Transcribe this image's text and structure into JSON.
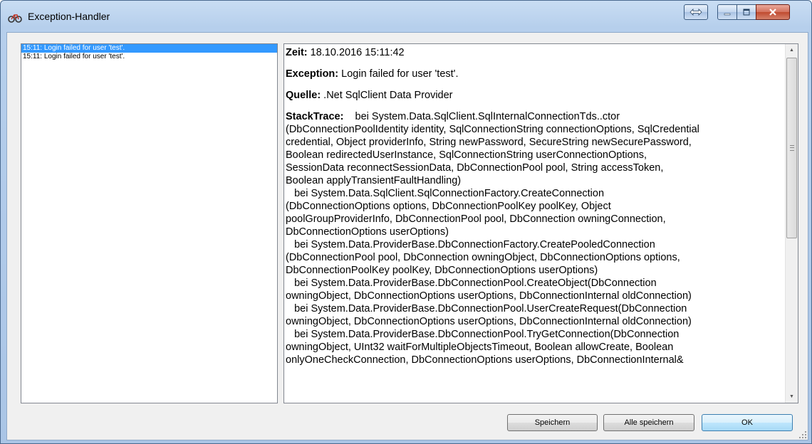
{
  "window": {
    "title": "Exception-Handler",
    "icon": "bicycle-app-icon",
    "accent": "#3399ff"
  },
  "log_list": {
    "items": [
      "15:11: Login failed for user 'test'.",
      "15:11: Login failed for user 'test'."
    ],
    "selected_index": 0
  },
  "detail": {
    "zeit_label": "Zeit:",
    "zeit_value": " 18.10.2016 15:11:42",
    "exception_label": "Exception:",
    "exception_value": " Login failed for user 'test'.",
    "quelle_label": "Quelle:",
    "quelle_value": " .Net SqlClient Data Provider",
    "stacktrace_label": "StackTrace:",
    "stacktrace_lines": [
      "    bei System.Data.SqlClient.SqlInternalConnectionTds..ctor",
      "(DbConnectionPoolIdentity identity, SqlConnectionString connectionOptions, SqlCredential",
      "credential, Object providerInfo, String newPassword, SecureString newSecurePassword,",
      "Boolean redirectedUserInstance, SqlConnectionString userConnectionOptions,",
      "SessionData reconnectSessionData, DbConnectionPool pool, String accessToken,",
      "Boolean applyTransientFaultHandling)",
      "   bei System.Data.SqlClient.SqlConnectionFactory.CreateConnection",
      "(DbConnectionOptions options, DbConnectionPoolKey poolKey, Object",
      "poolGroupProviderInfo, DbConnectionPool pool, DbConnection owningConnection,",
      "DbConnectionOptions userOptions)",
      "   bei System.Data.ProviderBase.DbConnectionFactory.CreatePooledConnection",
      "(DbConnectionPool pool, DbConnection owningObject, DbConnectionOptions options,",
      "DbConnectionPoolKey poolKey, DbConnectionOptions userOptions)",
      "   bei System.Data.ProviderBase.DbConnectionPool.CreateObject(DbConnection",
      "owningObject, DbConnectionOptions userOptions, DbConnectionInternal oldConnection)",
      "   bei System.Data.ProviderBase.DbConnectionPool.UserCreateRequest(DbConnection",
      "owningObject, DbConnectionOptions userOptions, DbConnectionInternal oldConnection)",
      "   bei System.Data.ProviderBase.DbConnectionPool.TryGetConnection(DbConnection",
      "owningObject, UInt32 waitForMultipleObjectsTimeout, Boolean allowCreate, Boolean",
      "onlyOneCheckConnection, DbConnectionOptions userOptions, DbConnectionInternal&"
    ]
  },
  "buttons": {
    "save_label": "Speichern",
    "save_all_label": "Alle speichern",
    "ok_label": "OK"
  }
}
